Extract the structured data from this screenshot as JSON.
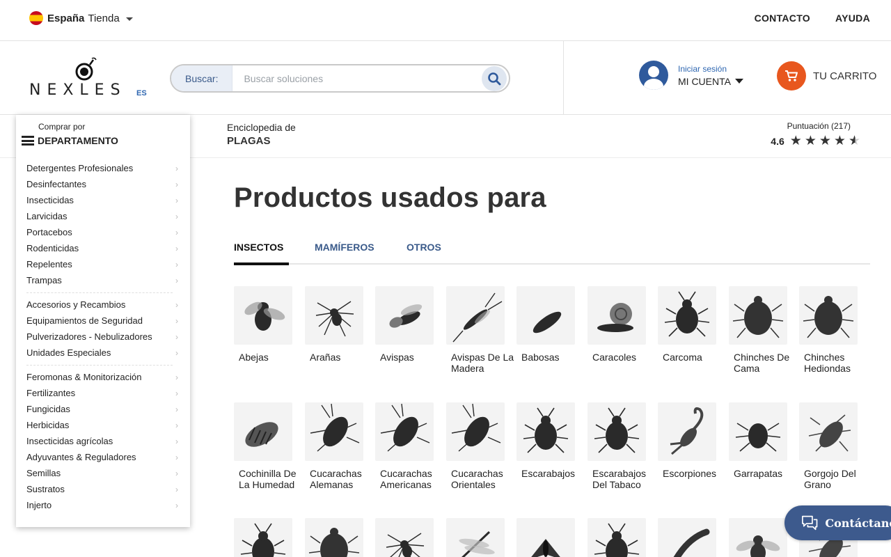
{
  "topbar": {
    "store_country": "España",
    "store_label": "Tienda",
    "links": [
      "CONTACTO",
      "AYUDA"
    ]
  },
  "header": {
    "logo_text": "NEXLES",
    "logo_suffix": "ES",
    "search_label": "Buscar:",
    "search_placeholder": "Buscar soluciones",
    "account_small": "Iniciar sesión",
    "account_big": "MI CUENTA",
    "cart_label": "TU CARRITO"
  },
  "subheader": {
    "ency_small": "Enciclopedia de",
    "ency_big": "PLAGAS",
    "rating_label": "Puntuación (217)",
    "rating_score": "4.6",
    "rating_value": 4.6,
    "rating_max": 5
  },
  "department": {
    "small": "Comprar por",
    "big": "DEPARTAMENTO",
    "groups": [
      [
        "Detergentes Profesionales",
        "Desinfectantes",
        "Insecticidas",
        "Larvicidas",
        "Portacebos",
        "Rodenticidas",
        "Repelentes",
        "Trampas"
      ],
      [
        "Accesorios y Recambios",
        "Equipamientos de Seguridad",
        "Pulverizadores - Nebulizadores",
        "Unidades Especiales"
      ],
      [
        "Feromonas & Monitorización",
        "Fertilizantes",
        "Fungicidas",
        "Herbicidas",
        "Insecticidas agrícolas",
        "Adyuvantes & Reguladores",
        "Semillas",
        "Sustratos",
        "Injerto"
      ]
    ]
  },
  "main": {
    "title": "Productos usados para",
    "tabs": [
      "INSECTOS",
      "MAMÍFEROS",
      "OTROS"
    ],
    "active_tab": "INSECTOS",
    "pests_row1": [
      "Abejas",
      "Arañas",
      "Avispas",
      "Avispas De La Madera",
      "Babosas",
      "Caracoles",
      "Carcoma",
      "Chinches De Cama",
      "Chinches Hediondas"
    ],
    "pests_row2": [
      "Cochinilla De La Humedad",
      "Cucarachas Alemanas",
      "Cucarachas Americanas",
      "Cucarachas Orientales",
      "Escarabajos",
      "Escarabajos Del Tabaco",
      "Escorpiones",
      "Garrapatas",
      "Gorgojo Del Grano"
    ]
  },
  "chat": {
    "label": "Contáctanos"
  },
  "colors": {
    "accent": "#3d5a8d",
    "cart": "#e8571e",
    "link": "#2f67b1"
  },
  "icons": [
    "spain-flag-icon",
    "search-icon",
    "user-icon",
    "cart-icon",
    "menu-icon",
    "star-icon",
    "chevron-right-icon",
    "chat-icon"
  ]
}
